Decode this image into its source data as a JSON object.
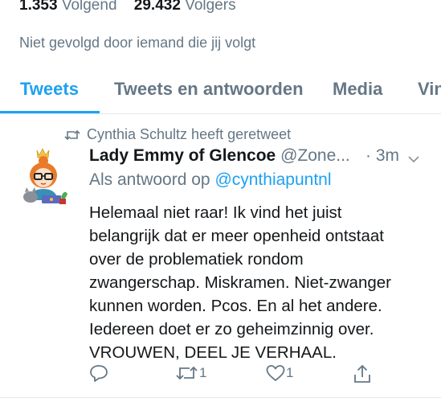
{
  "profile_stats": {
    "following_count": "1.353",
    "following_label": "Volgend",
    "followers_count": "29.432",
    "followers_label": "Volgers"
  },
  "not_followed_text": "Niet gevolgd door iemand die jij volgt",
  "tabs": [
    {
      "label": "Tweets",
      "active": true
    },
    {
      "label": "Tweets en antwoorden",
      "active": false
    },
    {
      "label": "Media",
      "active": false
    },
    {
      "label": "Vin",
      "active": false
    }
  ],
  "tweet": {
    "retweeted_by": "Cynthia Schultz heeft geretweet",
    "display_name": "Lady Emmy of Glencoe",
    "handle": "@Zone...",
    "time": "· 3m",
    "reply_prefix": "Als antwoord op",
    "reply_handle": "@cynthiapuntnl",
    "text_lines": [
      "Helemaal niet raar! Ik vind het juist",
      "belangrijk dat er meer openheid ontstaat",
      "over de problematiek rondom",
      "zwangerschap. Miskramen. Niet-zwanger",
      "kunnen worden. Pcos. En al het andere.",
      "Iedereen doet er zo geheimzinnig over.",
      "VROUWEN, DEEL JE VERHAAL."
    ],
    "actions": {
      "reply_count": "",
      "retweet_count": "1",
      "like_count": "1"
    }
  },
  "colors": {
    "accent": "#1da1f2",
    "muted": "#657786",
    "text": "#14171a",
    "divider": "#e1e8ed"
  },
  "icons": [
    "retweet-icon",
    "chevron-down-icon",
    "reply-icon",
    "retweet-icon",
    "heart-icon",
    "share-icon"
  ]
}
